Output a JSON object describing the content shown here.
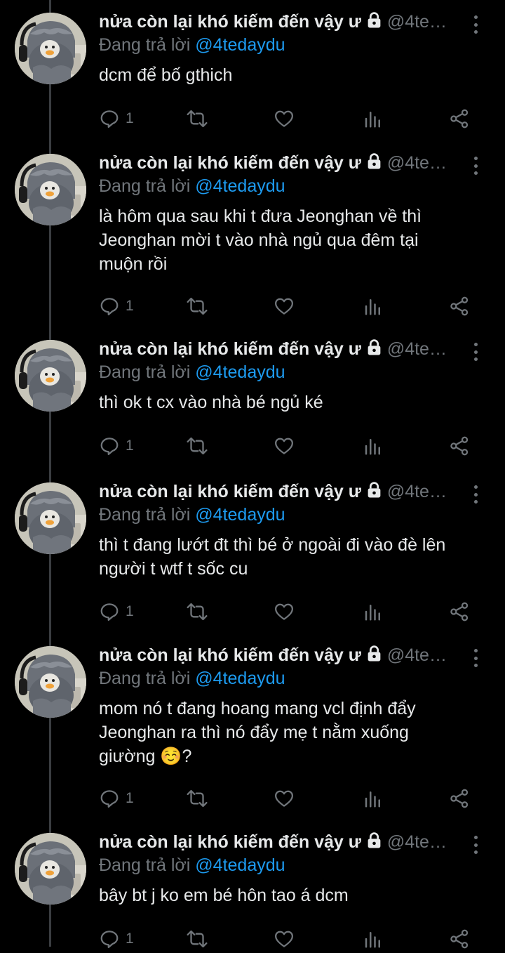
{
  "tweets": [
    {
      "name": "nửa còn lại khó kiếm đến vậy ư",
      "handle": "@4te…",
      "replying_label": "Đang trả lời ",
      "reply_to": "@4tedaydu",
      "lines": [
        "dcm để bố gthich"
      ],
      "reply_count": "1"
    },
    {
      "name": "nửa còn lại khó kiếm đến vậy ư",
      "handle": "@4te…",
      "replying_label": "Đang trả lời ",
      "reply_to": "@4tedaydu",
      "lines": [
        "là hôm qua sau khi t đưa Jeonghan về thì",
        "Jeonghan mời t vào nhà ngủ qua đêm tại",
        "muộn rồi"
      ],
      "reply_count": "1"
    },
    {
      "name": "nửa còn lại khó kiếm đến vậy ư",
      "handle": "@4te…",
      "replying_label": "Đang trả lời ",
      "reply_to": "@4tedaydu",
      "lines": [
        "thì ok t cx vào nhà bé ngủ ké"
      ],
      "reply_count": "1"
    },
    {
      "name": "nửa còn lại khó kiếm đến vậy ư",
      "handle": "@4te…",
      "replying_label": "Đang trả lời ",
      "reply_to": "@4tedaydu",
      "lines": [
        "thì t đang lướt đt thì bé ở ngoài đi vào đè lên",
        "người t wtf t sốc cu"
      ],
      "reply_count": "1"
    },
    {
      "name": "nửa còn lại khó kiếm đến vậy ư",
      "handle": "@4te…",
      "replying_label": "Đang trả lời ",
      "reply_to": "@4tedaydu",
      "lines": [
        "mom nó t đang hoang mang vcl định đẩy",
        "Jeonghan ra thì nó đẩy mẹ t nằm xuống",
        "giường ☺️?"
      ],
      "reply_count": "1"
    },
    {
      "name": "nửa còn lại khó kiếm đến vậy ư",
      "handle": "@4te…",
      "replying_label": "Đang trả lời ",
      "reply_to": "@4tedaydu",
      "lines": [
        "bây bt j ko em bé hôn tao á dcm"
      ],
      "reply_count": "1"
    }
  ],
  "icons": {
    "lock": "lock-icon",
    "reply": "reply-icon",
    "retweet": "retweet-icon",
    "like": "heart-icon",
    "views": "views-icon",
    "share": "share-icon",
    "more": "more-icon"
  },
  "colors": {
    "background": "#000000",
    "text": "#e7e9ea",
    "muted": "#71767b",
    "link": "#1d9bf0",
    "thread_line": "#3a3d41"
  }
}
